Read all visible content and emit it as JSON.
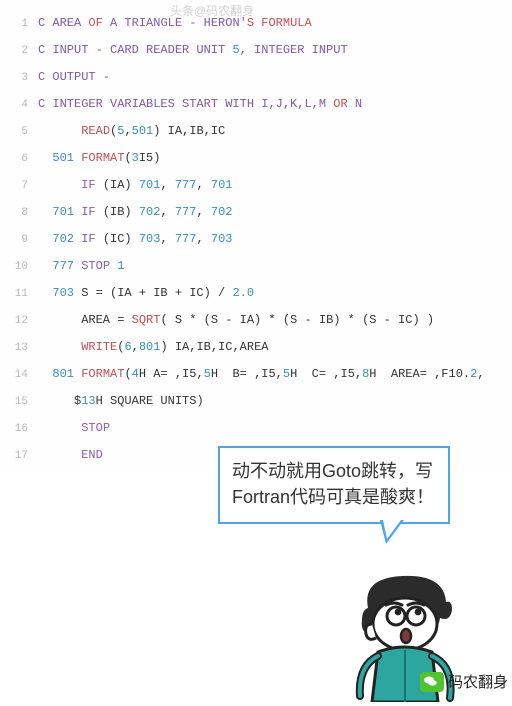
{
  "watermark_top": "头条@码农翻身",
  "watermark_bottom": "码农翻身",
  "speech_text": "动不动就用Goto跳转，写Fortran代码可真是酸爽！",
  "code": {
    "lines": [
      {
        "n": "1",
        "tokens": [
          [
            "c-comment",
            "C AREA "
          ],
          [
            "c-red",
            "OF"
          ],
          [
            "c-comment",
            " A TRIANGLE - HERON"
          ],
          [
            "c-red",
            "'S FORMULA"
          ]
        ]
      },
      {
        "n": "2",
        "tokens": [
          [
            "c-comment",
            "C INPUT - CARD READER UNIT "
          ],
          [
            "c-num",
            "5"
          ],
          [
            "c-comment",
            ", INTEGER INPUT"
          ]
        ]
      },
      {
        "n": "3",
        "tokens": [
          [
            "c-comment",
            "C OUTPUT -"
          ]
        ]
      },
      {
        "n": "4",
        "tokens": [
          [
            "c-comment",
            "C INTEGER VARIABLES START WITH I,J,K,L,M "
          ],
          [
            "c-red",
            "OR"
          ],
          [
            "c-comment",
            " N"
          ]
        ]
      },
      {
        "n": "5",
        "tokens": [
          [
            "c-op",
            "      "
          ],
          [
            "c-fn",
            "READ"
          ],
          [
            "c-op",
            "("
          ],
          [
            "c-num",
            "5"
          ],
          [
            "c-op",
            ","
          ],
          [
            "c-num",
            "501"
          ],
          [
            "c-op",
            ") IA,IB,IC"
          ]
        ]
      },
      {
        "n": "6",
        "tokens": [
          [
            "c-op",
            "  "
          ],
          [
            "c-num",
            "501"
          ],
          [
            "c-op",
            " "
          ],
          [
            "c-fn",
            "FORMAT"
          ],
          [
            "c-op",
            "("
          ],
          [
            "c-num",
            "3"
          ],
          [
            "c-op",
            "I5)"
          ]
        ]
      },
      {
        "n": "7",
        "tokens": [
          [
            "c-op",
            "      "
          ],
          [
            "c-kw",
            "IF"
          ],
          [
            "c-op",
            " (IA) "
          ],
          [
            "c-num",
            "701"
          ],
          [
            "c-op",
            ", "
          ],
          [
            "c-num",
            "777"
          ],
          [
            "c-op",
            ", "
          ],
          [
            "c-num",
            "701"
          ]
        ]
      },
      {
        "n": "8",
        "tokens": [
          [
            "c-op",
            "  "
          ],
          [
            "c-num",
            "701"
          ],
          [
            "c-op",
            " "
          ],
          [
            "c-kw",
            "IF"
          ],
          [
            "c-op",
            " (IB) "
          ],
          [
            "c-num",
            "702"
          ],
          [
            "c-op",
            ", "
          ],
          [
            "c-num",
            "777"
          ],
          [
            "c-op",
            ", "
          ],
          [
            "c-num",
            "702"
          ]
        ]
      },
      {
        "n": "9",
        "tokens": [
          [
            "c-op",
            "  "
          ],
          [
            "c-num",
            "702"
          ],
          [
            "c-op",
            " "
          ],
          [
            "c-kw",
            "IF"
          ],
          [
            "c-op",
            " (IC) "
          ],
          [
            "c-num",
            "703"
          ],
          [
            "c-op",
            ", "
          ],
          [
            "c-num",
            "777"
          ],
          [
            "c-op",
            ", "
          ],
          [
            "c-num",
            "703"
          ]
        ]
      },
      {
        "n": "10",
        "tokens": [
          [
            "c-op",
            "  "
          ],
          [
            "c-num",
            "777"
          ],
          [
            "c-op",
            " "
          ],
          [
            "c-kw",
            "STOP"
          ],
          [
            "c-op",
            " "
          ],
          [
            "c-num",
            "1"
          ]
        ]
      },
      {
        "n": "11",
        "tokens": [
          [
            "c-op",
            "  "
          ],
          [
            "c-num",
            "703"
          ],
          [
            "c-op",
            " S = (IA + IB + IC) / "
          ],
          [
            "c-num",
            "2.0"
          ]
        ]
      },
      {
        "n": "12",
        "tokens": [
          [
            "c-op",
            "      AREA = "
          ],
          [
            "c-fn",
            "SQRT"
          ],
          [
            "c-op",
            "( S * (S - IA) * (S - IB) * (S - IC) )"
          ]
        ]
      },
      {
        "n": "13",
        "tokens": [
          [
            "c-op",
            "      "
          ],
          [
            "c-fn",
            "WRITE"
          ],
          [
            "c-op",
            "("
          ],
          [
            "c-num",
            "6"
          ],
          [
            "c-op",
            ","
          ],
          [
            "c-num",
            "801"
          ],
          [
            "c-op",
            ") IA,IB,IC,AREA"
          ]
        ]
      },
      {
        "n": "14",
        "tokens": [
          [
            "c-op",
            "  "
          ],
          [
            "c-num",
            "801"
          ],
          [
            "c-op",
            " "
          ],
          [
            "c-fn",
            "FORMAT"
          ],
          [
            "c-op",
            "("
          ],
          [
            "c-num",
            "4"
          ],
          [
            "c-op",
            "H A= ,I5,"
          ],
          [
            "c-num",
            "5"
          ],
          [
            "c-op",
            "H  B= ,I5,"
          ],
          [
            "c-num",
            "5"
          ],
          [
            "c-op",
            "H  C= ,I5,"
          ],
          [
            "c-num",
            "8"
          ],
          [
            "c-op",
            "H  AREA= ,F10."
          ],
          [
            "c-num",
            "2"
          ],
          [
            "c-op",
            ","
          ]
        ]
      },
      {
        "n": "15",
        "tokens": [
          [
            "c-op",
            "     $"
          ],
          [
            "c-num",
            "13"
          ],
          [
            "c-op",
            "H SQUARE UNITS)"
          ]
        ]
      },
      {
        "n": "16",
        "tokens": [
          [
            "c-op",
            "      "
          ],
          [
            "c-kw",
            "STOP"
          ]
        ]
      },
      {
        "n": "17",
        "tokens": [
          [
            "c-op",
            "      "
          ],
          [
            "c-kw",
            "END"
          ]
        ]
      }
    ]
  }
}
